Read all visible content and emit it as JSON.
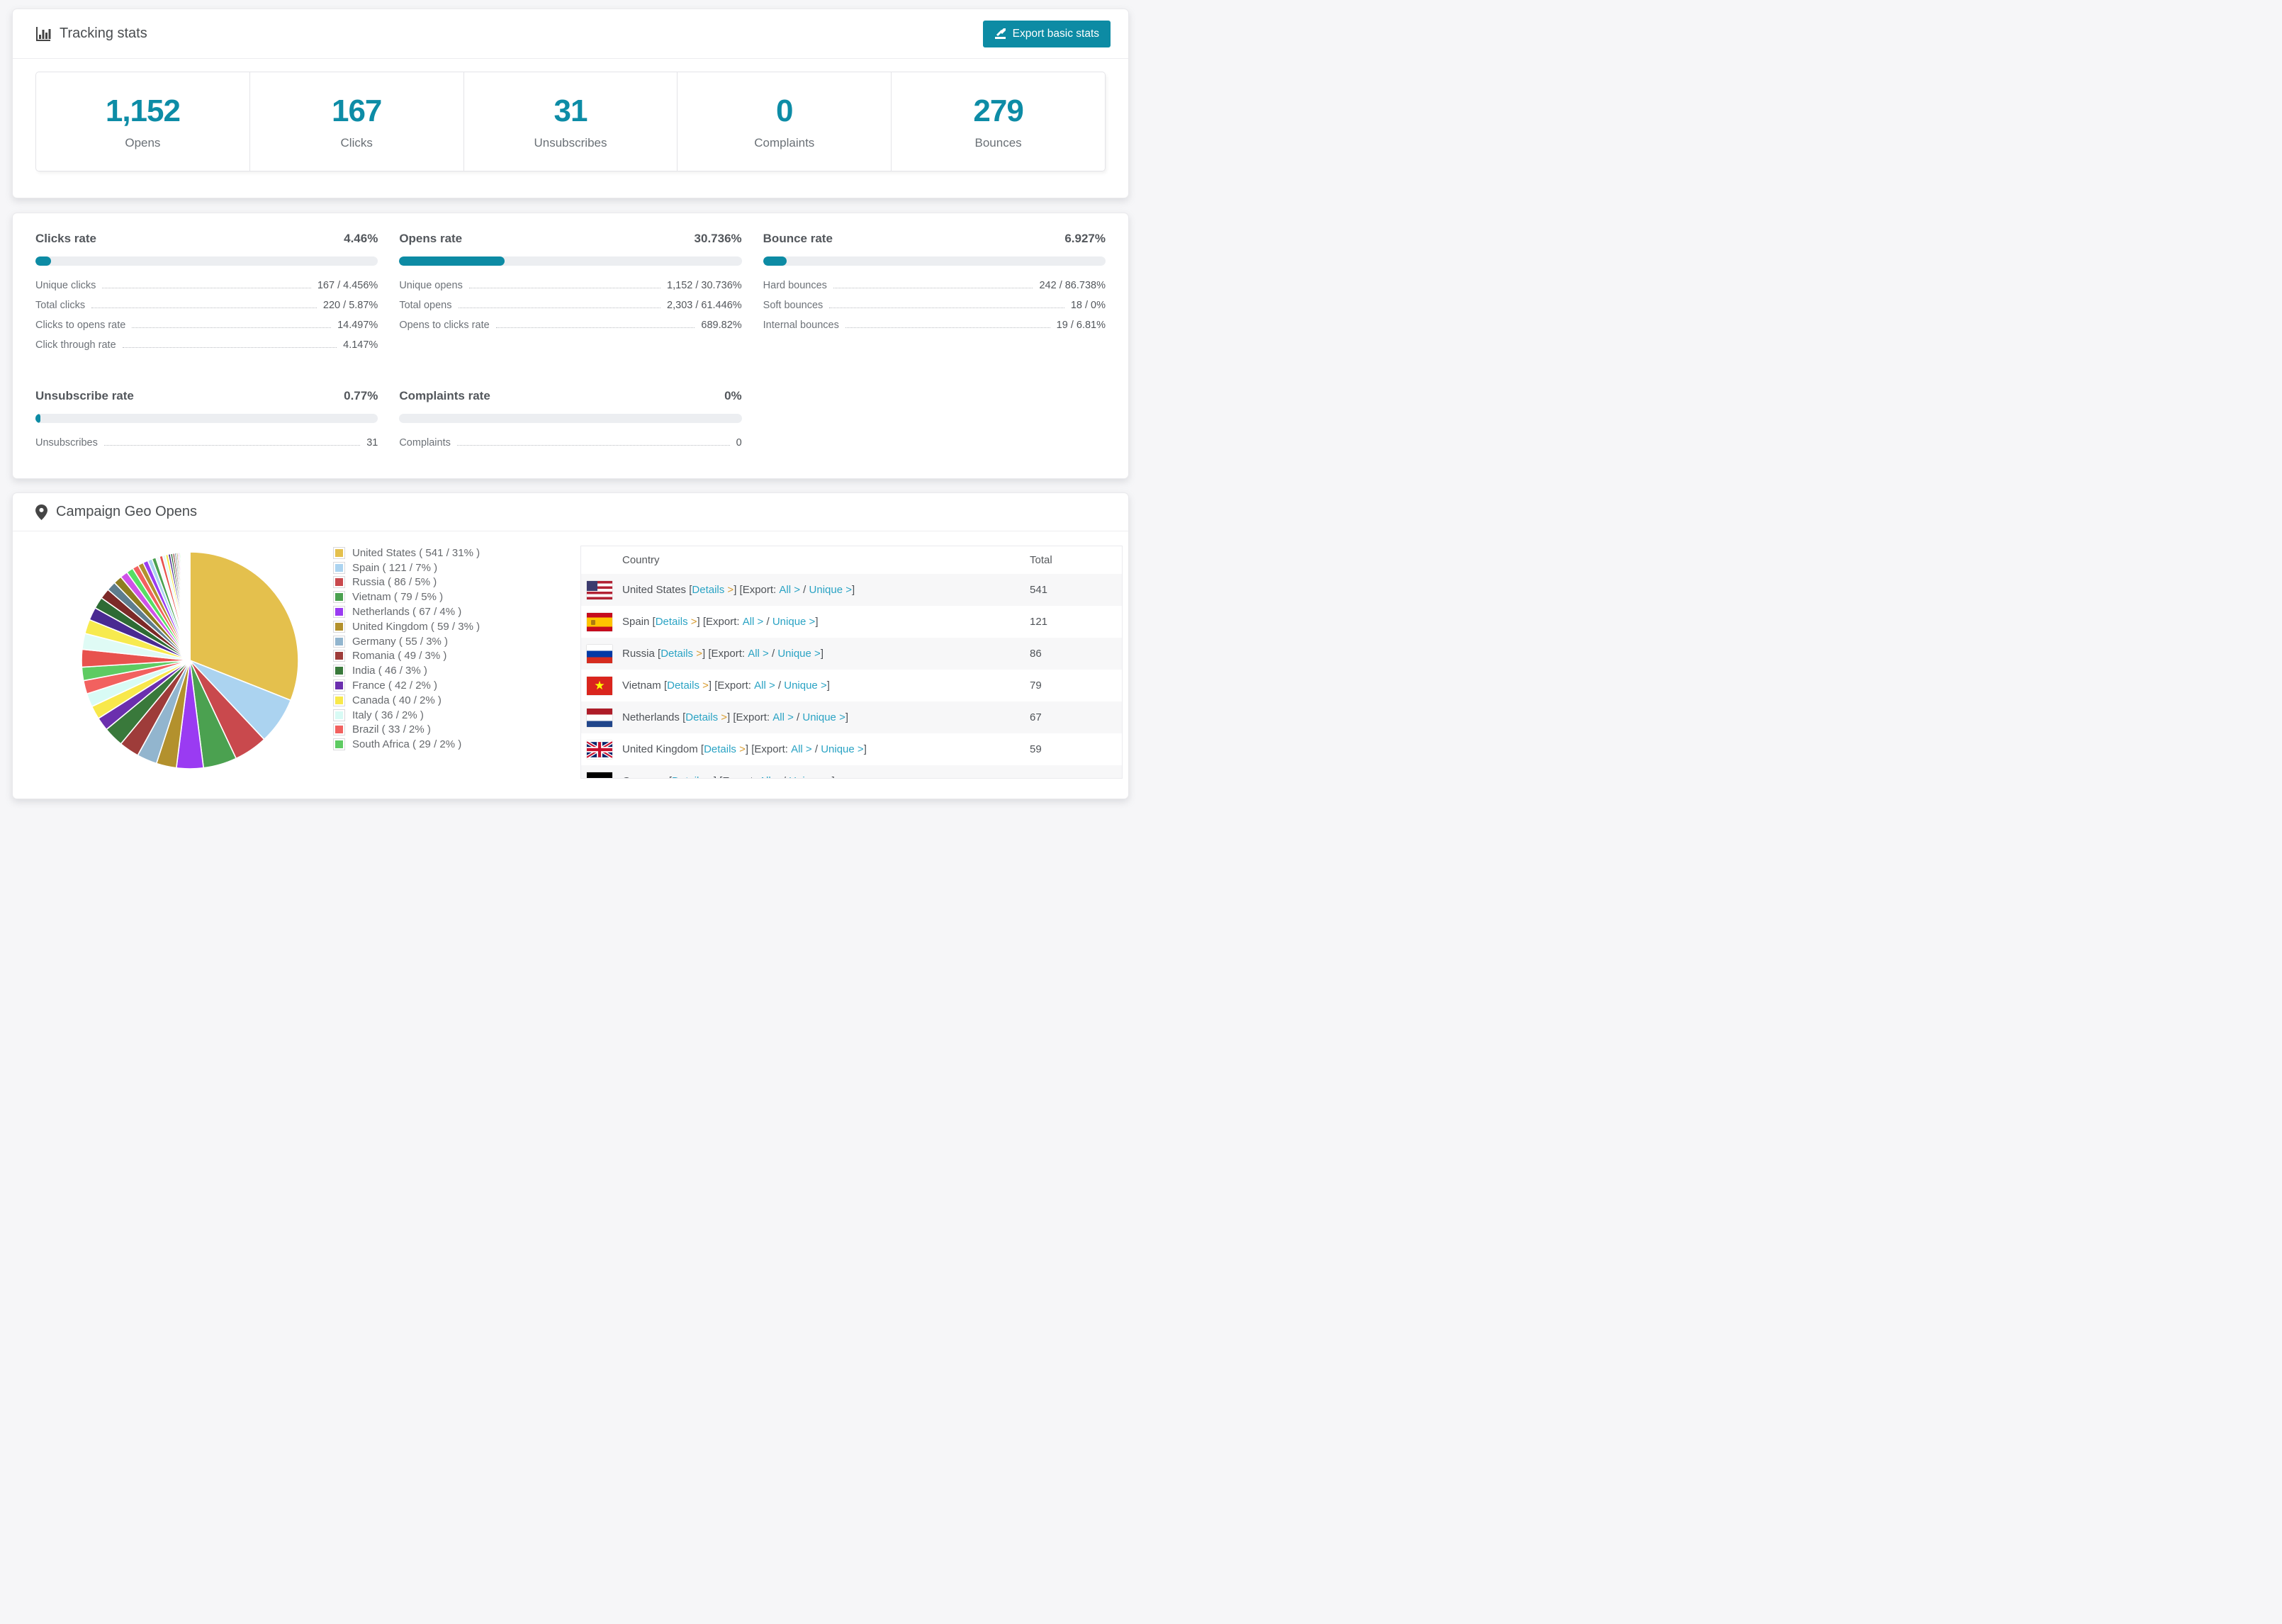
{
  "colors": {
    "accent_teal": "#0d8ba4",
    "stat_number_teal": "#0d8ca6",
    "link_teal": "#2aa3c4",
    "details_caret_orange": "#d89b2d",
    "progress_track": "#eceef1",
    "page_background": "#f6f6f8"
  },
  "header": {
    "title": "Tracking stats",
    "export_button_label": "Export basic stats",
    "icons": [
      "bar-chart-icon",
      "export-icon"
    ]
  },
  "summary_stats": [
    {
      "value": "1,152",
      "label": "Opens"
    },
    {
      "value": "167",
      "label": "Clicks"
    },
    {
      "value": "31",
      "label": "Unsubscribes"
    },
    {
      "value": "0",
      "label": "Complaints"
    },
    {
      "value": "279",
      "label": "Bounces"
    }
  ],
  "rates": [
    {
      "title": "Clicks rate",
      "value_label": "4.46%",
      "percent": 4.46,
      "rows": [
        [
          "Unique clicks",
          "167 / 4.456%"
        ],
        [
          "Total clicks",
          "220 / 5.87%"
        ],
        [
          "Clicks to opens rate",
          "14.497%"
        ],
        [
          "Click through rate",
          "4.147%"
        ]
      ]
    },
    {
      "title": "Opens rate",
      "value_label": "30.736%",
      "percent": 30.736,
      "rows": [
        [
          "Unique opens",
          "1,152 / 30.736%"
        ],
        [
          "Total opens",
          "2,303 / 61.446%"
        ],
        [
          "Opens to clicks rate",
          "689.82%"
        ]
      ]
    },
    {
      "title": "Bounce rate",
      "value_label": "6.927%",
      "percent": 6.927,
      "rows": [
        [
          "Hard bounces",
          "242 / 86.738%"
        ],
        [
          "Soft bounces",
          "18 / 0%"
        ],
        [
          "Internal bounces",
          "19 / 6.81%"
        ]
      ]
    },
    {
      "title": "Unsubscribe rate",
      "value_label": "0.77%",
      "percent": 0.77,
      "rows": [
        [
          "Unsubscribes",
          "31"
        ]
      ]
    },
    {
      "title": "Complaints rate",
      "value_label": "0%",
      "percent": 0,
      "rows": [
        [
          "Complaints",
          "0"
        ]
      ]
    }
  ],
  "geo": {
    "title": "Campaign Geo Opens",
    "icon": "map-pin-icon",
    "table": {
      "headers": [
        "Country",
        "Total"
      ],
      "link_labels": {
        "details": "Details",
        "export_prefix": "Export:",
        "all": "All",
        "unique": "Unique",
        "caret": ">"
      },
      "rows": [
        {
          "country": "United States",
          "flag": "us",
          "total": "541"
        },
        {
          "country": "Spain",
          "flag": "es",
          "total": "121"
        },
        {
          "country": "Russia",
          "flag": "ru",
          "total": "86"
        },
        {
          "country": "Vietnam",
          "flag": "vn",
          "total": "79"
        },
        {
          "country": "Netherlands",
          "flag": "nl",
          "total": "67"
        },
        {
          "country": "United Kingdom",
          "flag": "gb",
          "total": "59"
        }
      ],
      "partially_visible_row": {
        "country": "Germany",
        "flag": "de"
      }
    }
  },
  "chart_data": {
    "type": "pie",
    "title": "Campaign Geo Opens",
    "legend_position": "right",
    "start_angle_deg": 0,
    "direction": "clockwise",
    "legend_format": "{label} ( {value} / {percent}% )",
    "slices": [
      {
        "label": "United States",
        "value": 541,
        "percent": 31,
        "color": "#e4c04d"
      },
      {
        "label": "Spain",
        "value": 121,
        "percent": 7,
        "color": "#abd3f0"
      },
      {
        "label": "Russia",
        "value": 86,
        "percent": 5,
        "color": "#c9494d"
      },
      {
        "label": "Vietnam",
        "value": 79,
        "percent": 5,
        "color": "#4ba150"
      },
      {
        "label": "Netherlands",
        "value": 67,
        "percent": 4,
        "color": "#9a3bf2"
      },
      {
        "label": "United Kingdom",
        "value": 59,
        "percent": 3,
        "color": "#b3912d"
      },
      {
        "label": "Germany",
        "value": 55,
        "percent": 3,
        "color": "#92b5ce"
      },
      {
        "label": "Romania",
        "value": 49,
        "percent": 3,
        "color": "#9e3c3a"
      },
      {
        "label": "India",
        "value": 46,
        "percent": 3,
        "color": "#39793b"
      },
      {
        "label": "France",
        "value": 42,
        "percent": 2,
        "color": "#6b2fae"
      },
      {
        "label": "Canada",
        "value": 40,
        "percent": 2,
        "color": "#f8e84b"
      },
      {
        "label": "Italy",
        "value": 36,
        "percent": 2,
        "color": "#d8fbf5"
      },
      {
        "label": "Brazil",
        "value": 33,
        "percent": 2,
        "color": "#f2615f"
      },
      {
        "label": "South Africa",
        "value": 29,
        "percent": 2,
        "color": "#5ecb62"
      }
    ],
    "others_unlabeled": {
      "note": "many small unlabeled slices fanning to 12 o'clock",
      "percent_total": 26,
      "slice_count": 42,
      "decay": 0.9,
      "palette": [
        "#e8524e",
        "#dffbf5",
        "#f7ea4e",
        "#4a2a92",
        "#2e6b34",
        "#7c2a28",
        "#5e7d8d",
        "#8f7d1f",
        "#cf52e8",
        "#57de64",
        "#f2615f",
        "#b3912d",
        "#9a3bf2",
        "#abd3f0",
        "#4ba150",
        "#f5f9ff"
      ]
    }
  }
}
